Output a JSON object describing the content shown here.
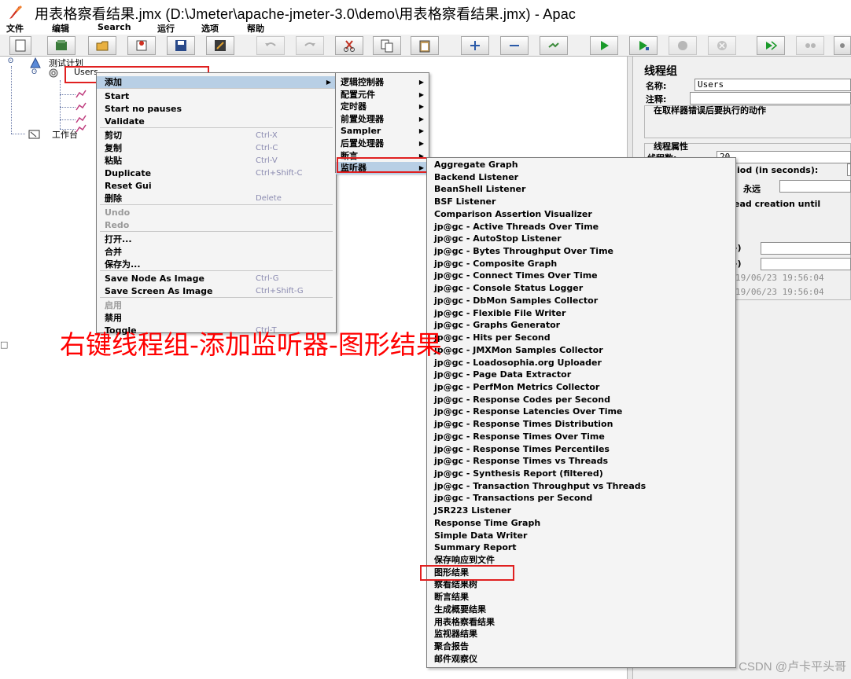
{
  "window": {
    "title": "用表格察看结果.jmx (D:\\Jmeter\\apache-jmeter-3.0\\demo\\用表格察看结果.jmx) - Apac"
  },
  "menubar": [
    "文件",
    "编辑",
    "Search",
    "运行",
    "选项",
    "帮助"
  ],
  "toolbar": {
    "buttons": [
      "new-icon",
      "templates-icon",
      "open-icon",
      "open-recent-icon",
      "save-icon",
      "save-as-icon",
      "undo-icon",
      "redo-icon",
      "cut-icon",
      "copy-icon",
      "paste-icon",
      "expand-icon",
      "collapse-icon",
      "toggle-icon",
      "start-icon",
      "start-no-pauses-icon",
      "stop-icon",
      "shutdown-icon",
      "remote-start-icon",
      "remote-stop-icon"
    ]
  },
  "tree": {
    "root": "测试计划",
    "thread_group": "Users",
    "workbench": "工作台"
  },
  "context_menu": {
    "items": [
      {
        "label": "添加",
        "submenu": true,
        "selected": true
      },
      {
        "sep": true
      },
      {
        "label": "Start"
      },
      {
        "label": "Start no pauses"
      },
      {
        "label": "Validate"
      },
      {
        "sep": true
      },
      {
        "label": "剪切",
        "accel": "Ctrl-X"
      },
      {
        "label": "复制",
        "accel": "Ctrl-C"
      },
      {
        "label": "粘贴",
        "accel": "Ctrl-V"
      },
      {
        "label": "Duplicate",
        "accel": "Ctrl+Shift-C"
      },
      {
        "label": "Reset Gui"
      },
      {
        "label": "删除",
        "accel": "Delete"
      },
      {
        "sep": true
      },
      {
        "label": "Undo",
        "disabled": true
      },
      {
        "label": "Redo",
        "disabled": true
      },
      {
        "sep": true
      },
      {
        "label": "打开..."
      },
      {
        "label": "合并"
      },
      {
        "label": "保存为..."
      },
      {
        "sep": true
      },
      {
        "label": "Save Node As Image",
        "accel": "Ctrl-G"
      },
      {
        "label": "Save Screen As Image",
        "accel": "Ctrl+Shift-G"
      },
      {
        "sep": true
      },
      {
        "label": "启用",
        "disabled": true
      },
      {
        "label": "禁用"
      },
      {
        "label": "Toggle",
        "accel": "Ctrl-T"
      }
    ]
  },
  "add_submenu": {
    "items": [
      "逻辑控制器",
      "配置元件",
      "定时器",
      "前置处理器",
      "Sampler",
      "后置处理器",
      "断言",
      "监听器"
    ]
  },
  "listener_submenu": {
    "items": [
      "Aggregate Graph",
      "Backend Listener",
      "BeanShell Listener",
      "BSF Listener",
      "Comparison Assertion Visualizer",
      "jp@gc - Active Threads Over Time",
      "jp@gc - AutoStop Listener",
      "jp@gc - Bytes Throughput Over Time",
      "jp@gc - Composite Graph",
      "jp@gc - Connect Times Over Time",
      "jp@gc - Console Status Logger",
      "jp@gc - DbMon Samples Collector",
      "jp@gc - Flexible File Writer",
      "jp@gc - Graphs Generator",
      "jp@gc - Hits per Second",
      "jp@gc - JMXMon Samples Collector",
      "jp@gc - Loadosophia.org Uploader",
      "jp@gc - Page Data Extractor",
      "jp@gc - PerfMon Metrics Collector",
      "jp@gc - Response Codes per Second",
      "jp@gc - Response Latencies Over Time",
      "jp@gc - Response Times Distribution",
      "jp@gc - Response Times Over Time",
      "jp@gc - Response Times Percentiles",
      "jp@gc - Response Times vs Threads",
      "jp@gc - Synthesis Report (filtered)",
      "jp@gc - Transaction Throughput vs Threads",
      "jp@gc - Transactions per Second",
      "JSR223 Listener",
      "Response Time Graph",
      "Simple Data Writer",
      "Summary Report",
      "保存响应到文件",
      "图形结果",
      "察看结果树",
      "断言结果",
      "生成概要结果",
      "用表格察看结果",
      "监视器结果",
      "聚合报告",
      "邮件观察仪"
    ],
    "highlighted": "图形结果"
  },
  "right_panel": {
    "title": "线程组",
    "name_label": "名称:",
    "name_value": "Users",
    "comment_label": "注释:",
    "error_action_label": "在取样器错误后要执行的动作",
    "thread_props_label": "线程属性",
    "thread_count_label": "线程数:",
    "thread_count_value": "20",
    "ramp_fragment": "iod (in seconds):",
    "forever_fragment": "永远",
    "delay_fragment": "ead creation until",
    "start_time": "19/06/23 19:56:04",
    "end_time": "19/06/23 19:56:04"
  },
  "annotation": "右键线程组-添加监听器-图形结果",
  "watermark": "CSDN @卢卡平头哥",
  "colors": {
    "highlight_box": "#e02020",
    "annotation": "#ff0000",
    "menu_bg": "#f4f4f4",
    "selection": "#b8cfe5"
  }
}
